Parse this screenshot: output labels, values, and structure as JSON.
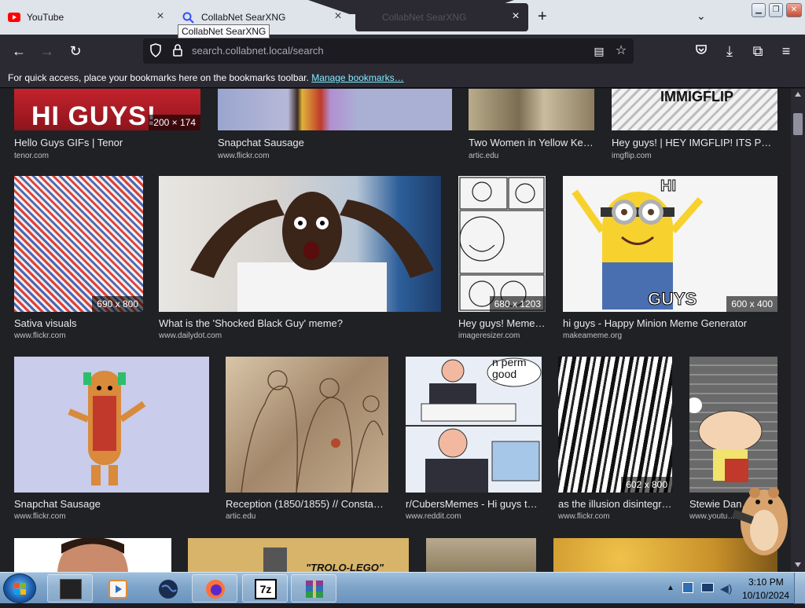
{
  "tabs": [
    {
      "label": "YouTube"
    },
    {
      "label": "CollabNet SearXNG"
    },
    {
      "label": "CollabNet SearXNG"
    }
  ],
  "tooltip": "CollabNet SearXNG",
  "url": {
    "host": "search.collabnet.local",
    "path": "/search"
  },
  "bookmarks_bar": {
    "message": "For quick access, place your bookmarks here on the bookmarks toolbar.",
    "link": "Manage bookmarks…"
  },
  "results": [
    {
      "title": "Hello Guys GIFs | Tenor",
      "source": "tenor.com",
      "dims": "200 × 174",
      "thumb_text": "HI GUYS!"
    },
    {
      "title": "Snapchat Sausage",
      "source": "www.flickr.com",
      "dims": "",
      "thumb_text": ""
    },
    {
      "title": "Two Women in Yellow Ke…",
      "source": "artic.edu",
      "dims": "",
      "thumb_text": ""
    },
    {
      "title": "Hey guys! | HEY IMGFLIP! ITS P…",
      "source": "imgflip.com",
      "dims": "",
      "thumb_text": "IMMIGFLIP"
    },
    {
      "title": "Sativa visuals",
      "source": "www.flickr.com",
      "dims": "690 x 800",
      "thumb_text": ""
    },
    {
      "title": "What is the 'Shocked Black Guy' meme?",
      "source": "www.dailydot.com",
      "dims": "",
      "thumb_text": ""
    },
    {
      "title": "Hey guys! Meme …",
      "source": "imageresizer.com",
      "dims": "680 x 1203",
      "thumb_text": ""
    },
    {
      "title": "hi guys - Happy Minion Meme Generator",
      "source": "makeameme.org",
      "dims": "600 x 400",
      "thumb_text": "HI",
      "thumb_text2": "GUYS"
    },
    {
      "title": "Snapchat Sausage",
      "source": "www.flickr.com",
      "dims": "",
      "thumb_text": ""
    },
    {
      "title": "Reception (1850/1855) // Consta…",
      "source": "artic.edu",
      "dims": "",
      "thumb_text": ""
    },
    {
      "title": "r/CubersMemes - Hi guys t…",
      "source": "www.reddit.com",
      "dims": "",
      "thumb_text": "n perm good"
    },
    {
      "title": "as the illusion disintegr…",
      "source": "www.flickr.com",
      "dims": "602 x 800",
      "thumb_text": ""
    },
    {
      "title": "Stewie Dan…",
      "source": "www.youtu…",
      "dims": "",
      "thumb_text": ""
    },
    {
      "title": "",
      "source": "",
      "dims": "",
      "thumb_text": ""
    },
    {
      "title": "",
      "source": "",
      "dims": "",
      "thumb_text": "\"TROLO-LEGO\""
    },
    {
      "title": "",
      "source": "",
      "dims": "",
      "thumb_text": ""
    },
    {
      "title": "",
      "source": "",
      "dims": "",
      "thumb_text": ""
    }
  ],
  "taskbar": {
    "apps": [
      "terminal",
      "media-player",
      "globe",
      "firefox",
      "7-zip",
      "winrar"
    ]
  },
  "clock": {
    "time": "3:10 PM",
    "date": "10/10/2024"
  }
}
